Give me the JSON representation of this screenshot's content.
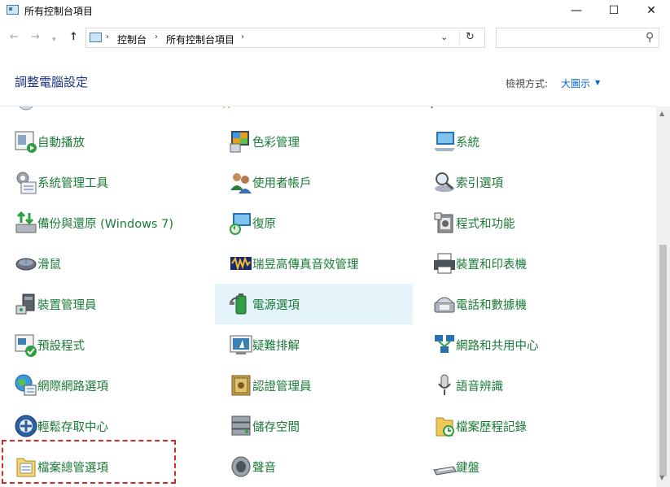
{
  "window": {
    "title": "所有控制台項目",
    "minimize": "—",
    "maximize": "☐",
    "close": "✕"
  },
  "nav": {
    "back": "←",
    "forward": "→",
    "recent": "▾",
    "up": "↑",
    "breadcrumb": [
      "控制台",
      "所有控制台項目"
    ],
    "separator": "›",
    "dropdown": "⌄",
    "refresh": "↻",
    "search_placeholder": ""
  },
  "header": {
    "title": "調整電腦設定",
    "view_by_label": "檢視方式:",
    "view_by_value": "大圖示"
  },
  "items": [
    [
      "自動播放",
      "色彩管理",
      "系統"
    ],
    [
      "系統管理工具",
      "使用者帳戶",
      "索引選項"
    ],
    [
      "備份與還原 (Windows 7)",
      "復原",
      "程式和功能"
    ],
    [
      "滑鼠",
      "瑞昱高傳真音效管理",
      "裝置和印表機"
    ],
    [
      "裝置管理員",
      "電源選項",
      "電話和數據機"
    ],
    [
      "預設程式",
      "疑難排解",
      "網路和共用中心"
    ],
    [
      "網際網路選項",
      "認證管理員",
      "語音辨識"
    ],
    [
      "輕鬆存取中心",
      "儲存空間",
      "檔案歷程記錄"
    ],
    [
      "檔案總管選項",
      "聲音",
      "鍵盤"
    ]
  ],
  "colors": {
    "item_text": "#1a7a37",
    "title_text": "#1e3287",
    "link": "#0066cc",
    "highlight_bg": "#e5f3fb",
    "annotation_border": "#d42a2a"
  }
}
